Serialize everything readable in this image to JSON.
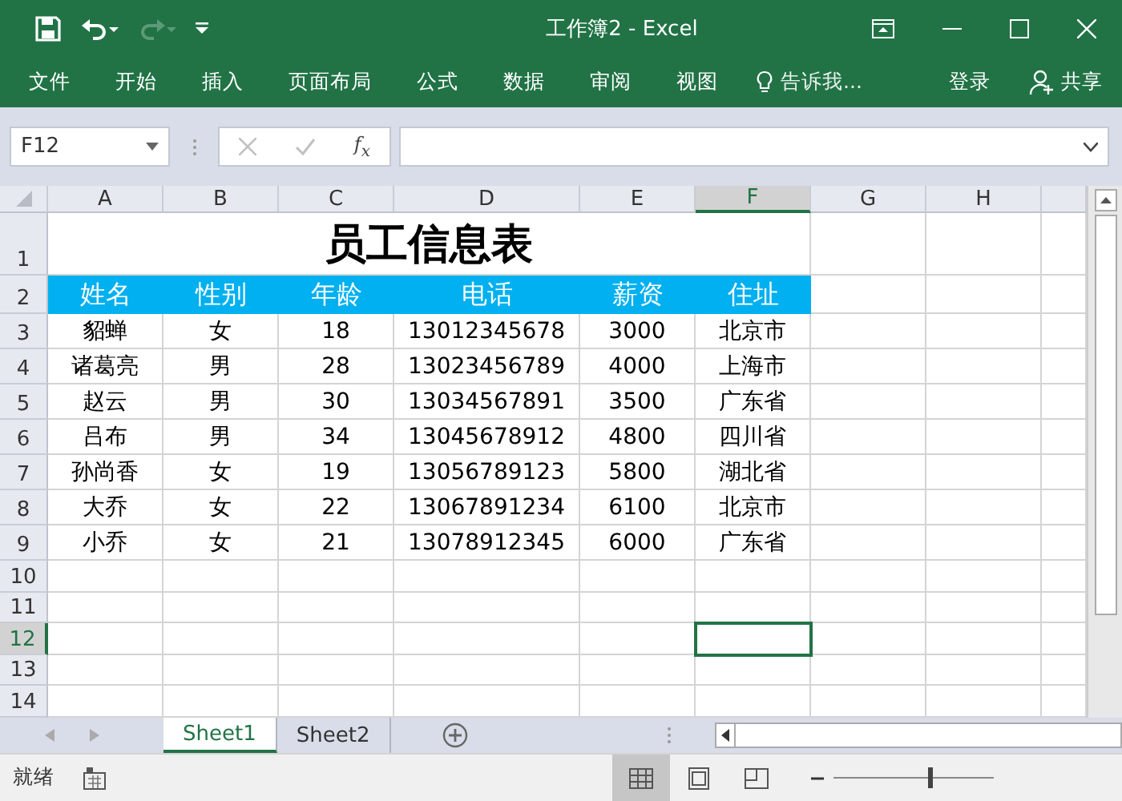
{
  "window": {
    "title": "工作簿2 - Excel"
  },
  "ribbon_tabs": [
    "文件",
    "开始",
    "插入",
    "页面布局",
    "公式",
    "数据",
    "审阅",
    "视图"
  ],
  "tell_me": "告诉我...",
  "account": {
    "sign_in": "登录",
    "share": "共享"
  },
  "name_box": {
    "value": "F12"
  },
  "formula_bar": {
    "function_label": "f$_{x}$"
  },
  "columns": [
    {
      "label": "A",
      "selected": false
    },
    {
      "label": "B",
      "selected": false
    },
    {
      "label": "C",
      "selected": false
    },
    {
      "label": "D",
      "selected": false
    },
    {
      "label": "E",
      "selected": false
    },
    {
      "label": "F",
      "selected": true
    },
    {
      "label": "G",
      "selected": false
    },
    {
      "label": "H",
      "selected": false
    }
  ],
  "row_headers": [
    {
      "label": "1",
      "selected": false
    },
    {
      "label": "2",
      "selected": false
    },
    {
      "label": "3",
      "selected": false
    },
    {
      "label": "4",
      "selected": false
    },
    {
      "label": "5",
      "selected": false
    },
    {
      "label": "6",
      "selected": false
    },
    {
      "label": "7",
      "selected": false
    },
    {
      "label": "8",
      "selected": false
    },
    {
      "label": "9",
      "selected": false
    },
    {
      "label": "10",
      "selected": false
    },
    {
      "label": "11",
      "selected": false
    },
    {
      "label": "12",
      "selected": true
    },
    {
      "label": "13",
      "selected": false
    },
    {
      "label": "14",
      "selected": false
    }
  ],
  "table": {
    "title": "员工信息表",
    "columns": [
      "姓名",
      "性别",
      "年龄",
      "电话",
      "薪资",
      "住址"
    ],
    "rows": [
      [
        "貂蝉",
        "女",
        "18",
        "13012345678",
        "3000",
        "北京市"
      ],
      [
        "诸葛亮",
        "男",
        "28",
        "13023456789",
        "4000",
        "上海市"
      ],
      [
        "赵云",
        "男",
        "30",
        "13034567891",
        "3500",
        "广东省"
      ],
      [
        "吕布",
        "男",
        "34",
        "13045678912",
        "4800",
        "四川省"
      ],
      [
        "孙尚香",
        "女",
        "19",
        "13056789123",
        "5800",
        "湖北省"
      ],
      [
        "大乔",
        "女",
        "22",
        "13067891234",
        "6100",
        "北京市"
      ],
      [
        "小乔",
        "女",
        "21",
        "13078912345",
        "6000",
        "广东省"
      ]
    ]
  },
  "sheet_tabs": [
    {
      "label": "Sheet1",
      "selected": true
    },
    {
      "label": "Sheet2",
      "selected": false
    }
  ],
  "status_bar": {
    "status": "就绪"
  },
  "view_buttons": [
    {
      "kind": "normal",
      "selected": true
    },
    {
      "kind": "page_layout",
      "selected": false
    },
    {
      "kind": "page_break",
      "selected": false
    }
  ],
  "zoom": {
    "level": 0.6
  }
}
